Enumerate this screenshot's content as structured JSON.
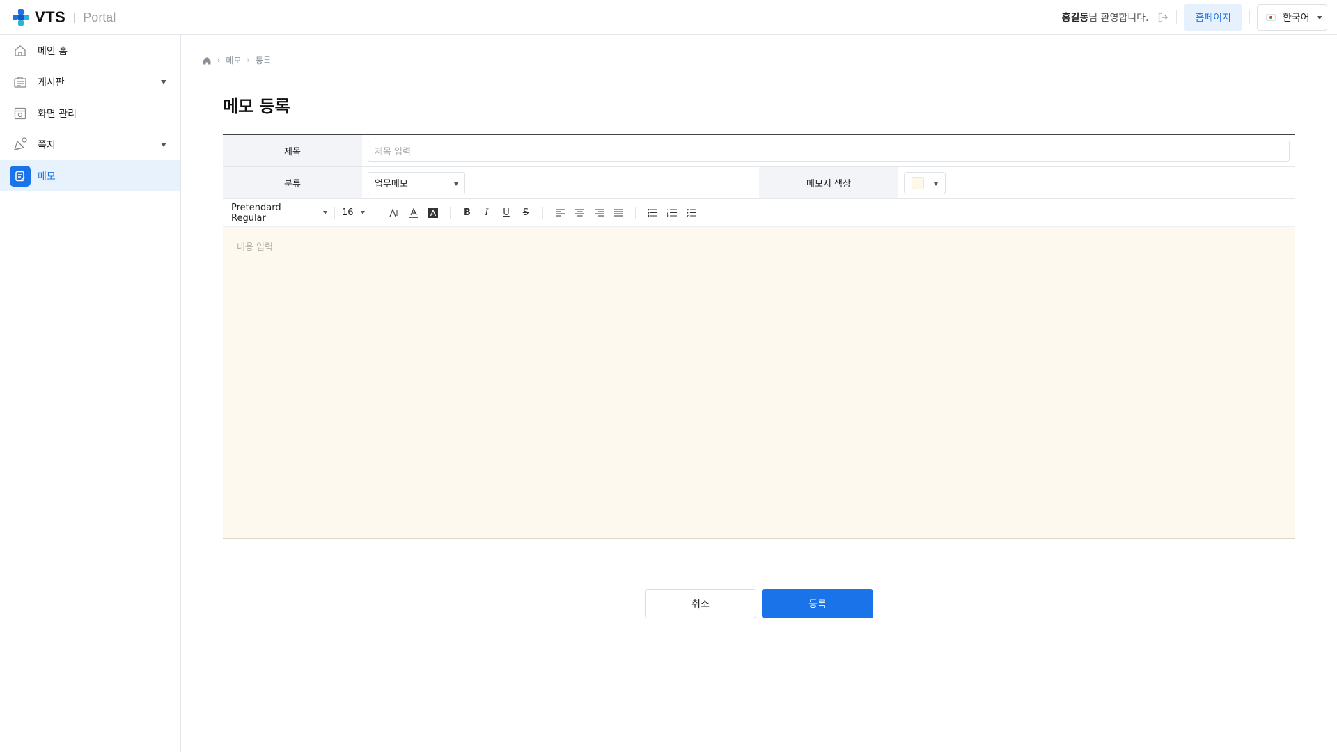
{
  "header": {
    "logo_text": "VTS",
    "logo_sub": "Portal",
    "user_name": "홍길동",
    "welcome_suffix": "님 환영합니다.",
    "home_label": "홈페이지",
    "language": "한국어"
  },
  "sidebar": {
    "items": [
      {
        "label": "메인 홈",
        "icon": "home-icon"
      },
      {
        "label": "게시판",
        "icon": "board-icon"
      },
      {
        "label": "화면 관리",
        "icon": "screen-icon"
      },
      {
        "label": "쪽지",
        "icon": "message-icon"
      },
      {
        "label": "메모",
        "icon": "memo-icon"
      }
    ]
  },
  "breadcrumb": {
    "items": [
      "메모",
      "등록"
    ]
  },
  "page": {
    "title": "메모 등록"
  },
  "form": {
    "title_label": "제목",
    "title_placeholder": "제목 입력",
    "category_label": "분류",
    "category_value": "업무메모",
    "color_label": "메모지 색상",
    "color_value": "#fdf8ea"
  },
  "toolbar": {
    "font": "Pretendard Regular",
    "size": "16"
  },
  "editor": {
    "placeholder": "내용 입력"
  },
  "actions": {
    "cancel": "취소",
    "submit": "등록"
  },
  "colors": {
    "accent": "#1a73e8",
    "active_bg": "#e8f2fd",
    "editor_bg": "#fdf9ee"
  }
}
